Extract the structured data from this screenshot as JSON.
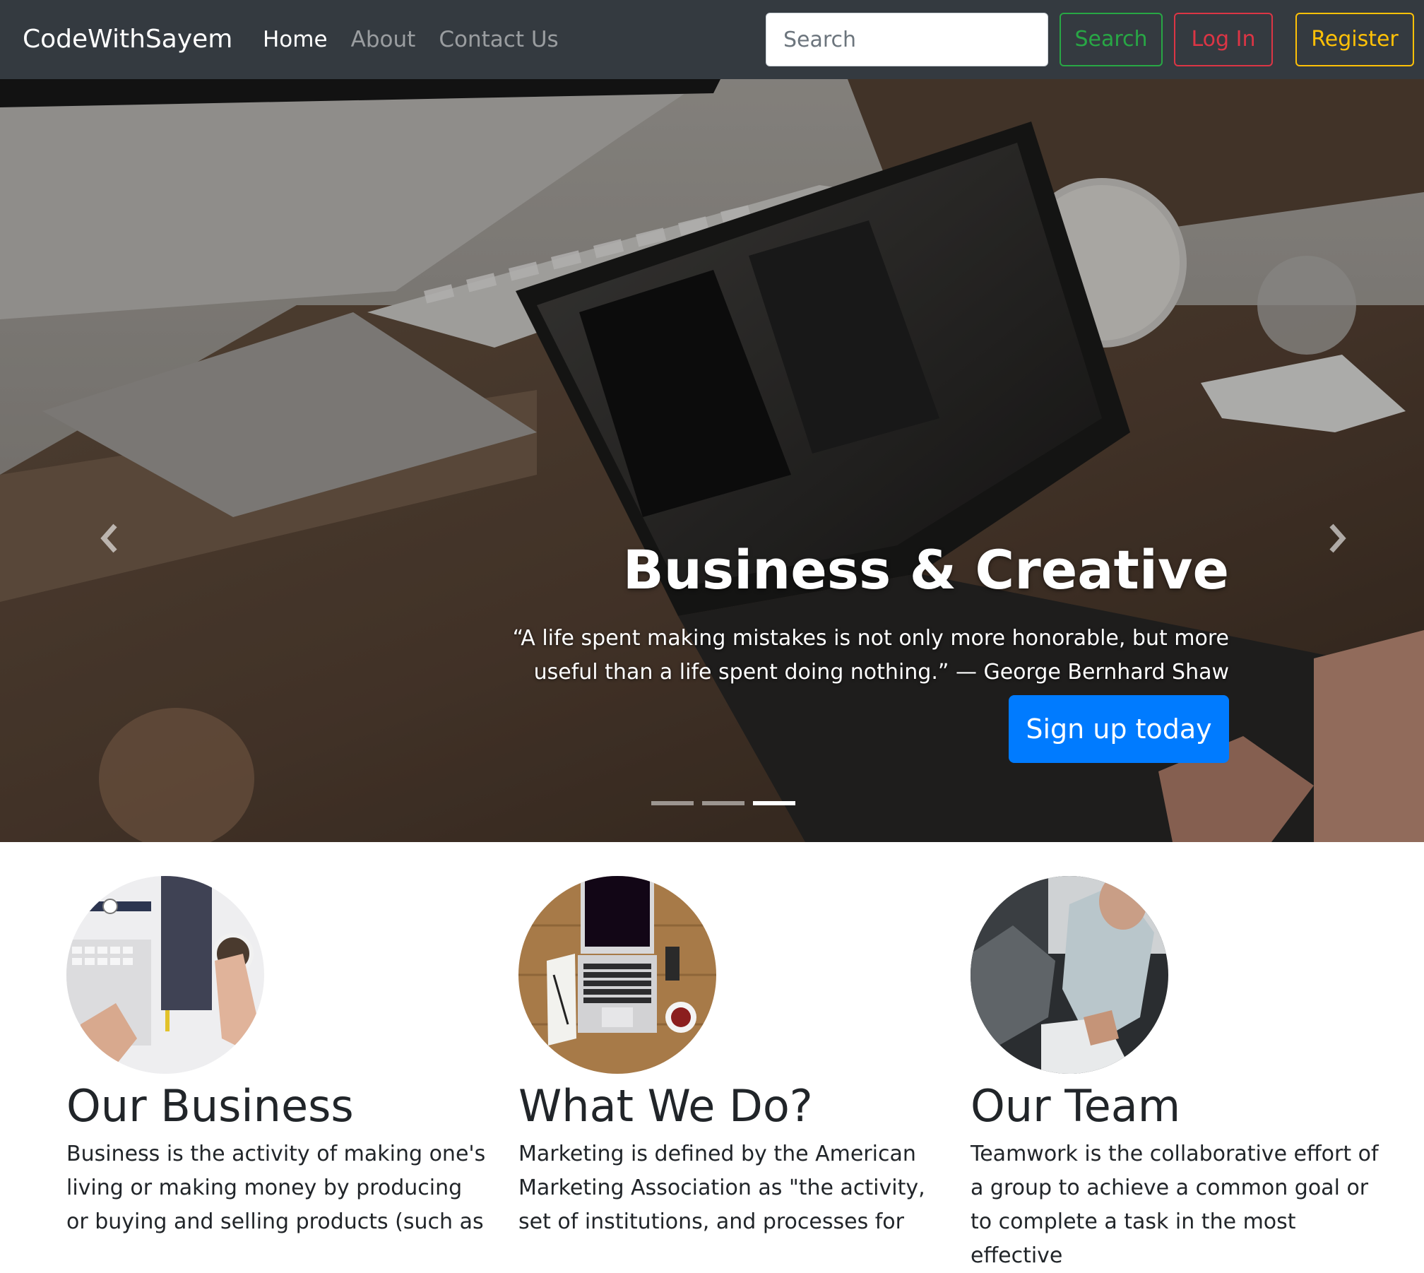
{
  "navbar": {
    "brand": "CodeWithSayem",
    "links": [
      {
        "label": "Home",
        "active": true
      },
      {
        "label": "About",
        "active": false
      },
      {
        "label": "Contact Us",
        "active": false
      }
    ],
    "search_placeholder": "Search",
    "search_button": "Search",
    "login_button": "Log In",
    "register_button": "Register"
  },
  "hero": {
    "title": "Business & Creative",
    "quote": "“A life spent making mistakes is not only more honorable, but more useful than a life spent doing nothing.” — George Bernhard Shaw",
    "cta_label": "Sign up today",
    "slides_total": 3,
    "active_slide": 3,
    "prev_icon": "chevron-left-icon",
    "next_icon": "chevron-right-icon"
  },
  "features": [
    {
      "title": "Our Business",
      "text": "Business is the activity of making one's living or making money by producing or buying and selling products (such as",
      "image": "desk-keyboard-notebook-coffee"
    },
    {
      "title": "What We Do?",
      "text": "Marketing is defined by the American Marketing Association as \"the activity, set of institutions, and processes for",
      "image": "laptop-on-wooden-desk"
    },
    {
      "title": "Our Team",
      "text": "Teamwork is the collaborative effort of a group to achieve a common goal or to complete a task in the most effective",
      "image": "team-member-working"
    }
  ],
  "colors": {
    "navbar_bg": "#343a40",
    "primary": "#007bff",
    "success": "#28a745",
    "danger": "#dc3545",
    "warning": "#ffc107"
  }
}
